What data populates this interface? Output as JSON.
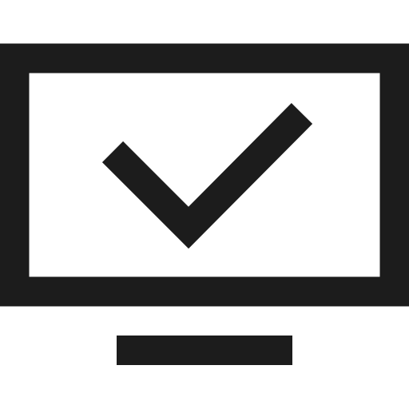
{
  "icon": {
    "name": "monitor-check-icon",
    "stroke_color": "#1c1c1c",
    "fill_color": "#ffffff",
    "background": "#ffffff",
    "parts": [
      "monitor-screen",
      "checkmark",
      "monitor-stand"
    ]
  }
}
